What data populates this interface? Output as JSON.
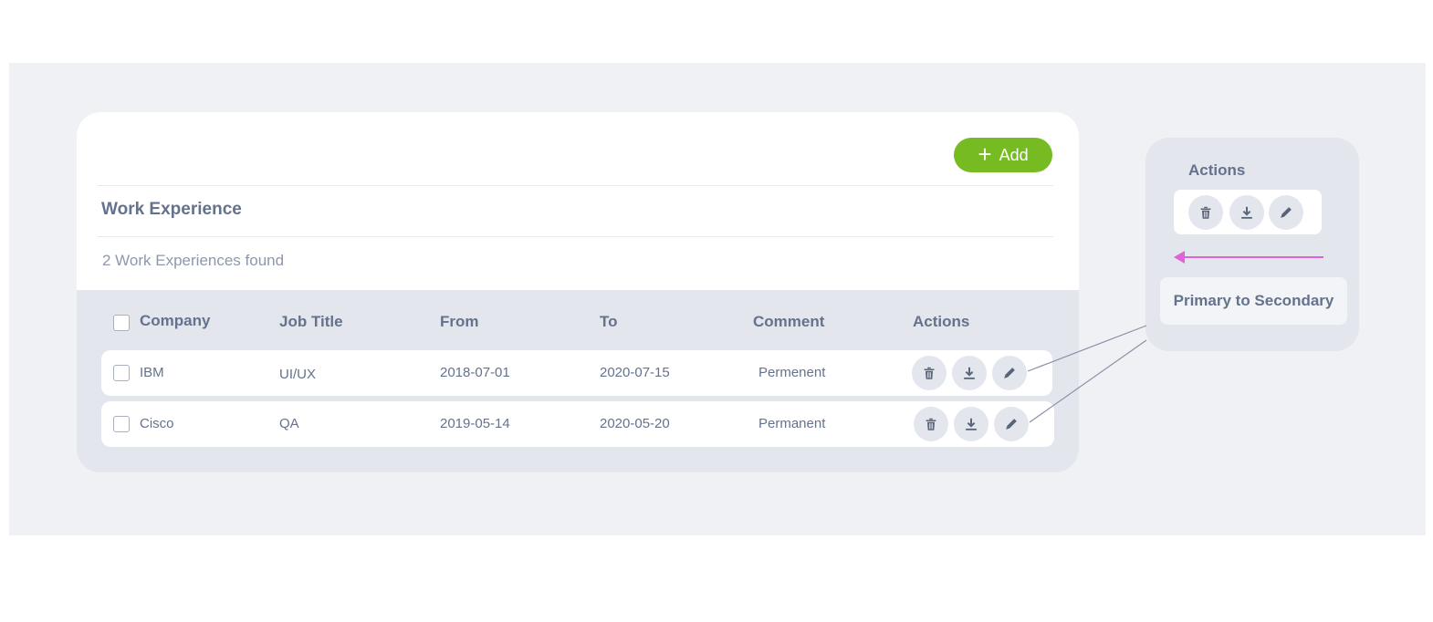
{
  "card": {
    "add_label": "Add",
    "title": "Work Experience",
    "count_text": "2 Work Experiences found"
  },
  "table": {
    "columns": [
      "Company",
      "Job Title",
      "From",
      "To",
      "Comment",
      "Actions"
    ],
    "rows": [
      {
        "company": "IBM",
        "job_title": "UI/UX",
        "from": "2018-07-01",
        "to": "2020-07-15",
        "comment": "Permenent"
      },
      {
        "company": "Cisco",
        "job_title": "QA",
        "from": "2019-05-14",
        "to": "2020-05-20",
        "comment": "Permanent"
      }
    ],
    "action_icons": [
      "trash-icon",
      "download-icon",
      "pencil-icon"
    ]
  },
  "panel": {
    "title": "Actions",
    "label": "Primary to Secondary"
  },
  "colors": {
    "accent_green": "#76bb21",
    "text": "#64728c",
    "muted": "#8e98aa",
    "background": "#f0f1f5",
    "arrow": "#e062d6"
  }
}
